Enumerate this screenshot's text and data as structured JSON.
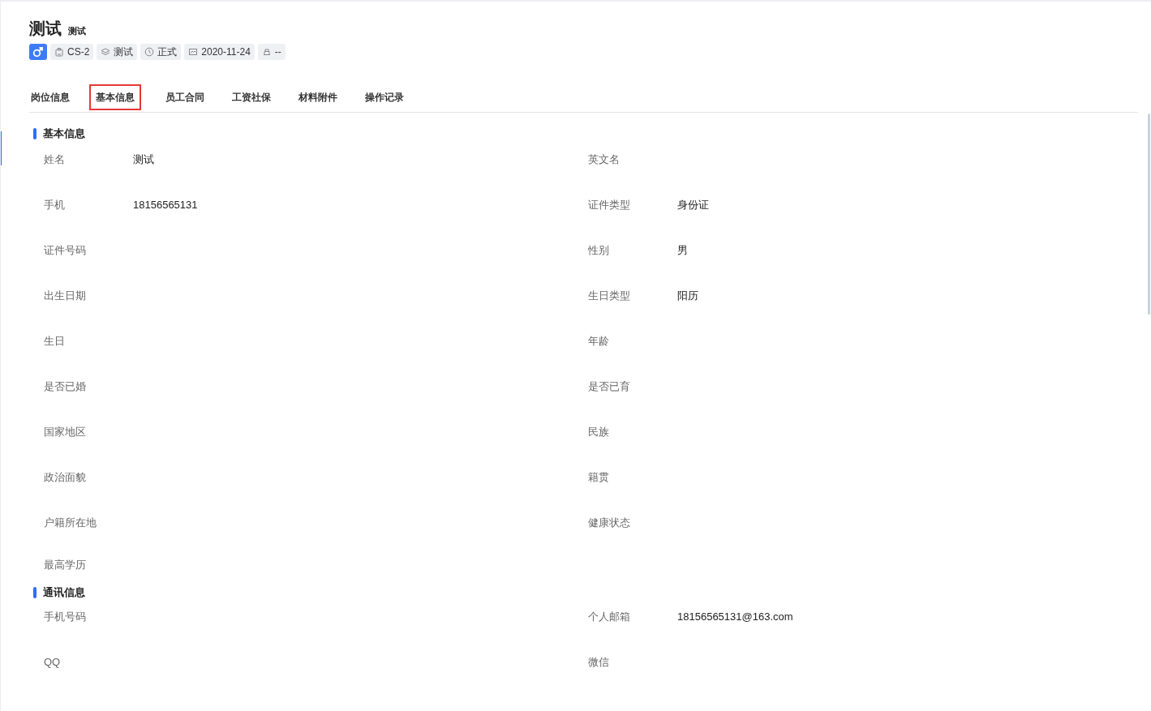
{
  "header": {
    "name": "测试",
    "subtitle": "测试",
    "gender": {
      "kind": "male"
    },
    "tags": [
      {
        "kind": "badge",
        "text": "CS-2"
      },
      {
        "kind": "layers",
        "text": "测试"
      },
      {
        "kind": "clock",
        "text": "正式"
      },
      {
        "kind": "calendar",
        "text": "2020-11-24"
      },
      {
        "kind": "seat",
        "text": "--"
      }
    ]
  },
  "tabs": [
    {
      "label": "岗位信息",
      "selected": false
    },
    {
      "label": "基本信息",
      "selected": true
    },
    {
      "label": "员工合同",
      "selected": false
    },
    {
      "label": "工资社保",
      "selected": false
    },
    {
      "label": "材料附件",
      "selected": false
    },
    {
      "label": "操作记录",
      "selected": false
    }
  ],
  "sections": [
    {
      "title": "基本信息",
      "fields": [
        {
          "label": "姓名",
          "value": "测试"
        },
        {
          "label": "英文名"
        },
        {
          "label": "手机",
          "value": "18156565131"
        },
        {
          "label": "证件类型",
          "value": "身份证"
        },
        {
          "label": "证件号码"
        },
        {
          "label": "性别",
          "value": "男"
        },
        {
          "label": "出生日期"
        },
        {
          "label": "生日类型",
          "value": "阳历"
        },
        {
          "label": "生日"
        },
        {
          "label": "年龄"
        },
        {
          "label": "是否已婚"
        },
        {
          "label": "是否已育"
        },
        {
          "label": "国家地区"
        },
        {
          "label": "民族"
        },
        {
          "label": "政治面貌"
        },
        {
          "label": "籍贯"
        },
        {
          "label": "户籍所在地"
        },
        {
          "label": "健康状态"
        },
        {
          "label": "最高学历"
        }
      ]
    },
    {
      "title": "通讯信息",
      "fields": [
        {
          "label": "手机号码"
        },
        {
          "label": "个人邮箱",
          "value": "18156565131@163.com"
        },
        {
          "label": "QQ"
        },
        {
          "label": "微信"
        }
      ]
    }
  ]
}
